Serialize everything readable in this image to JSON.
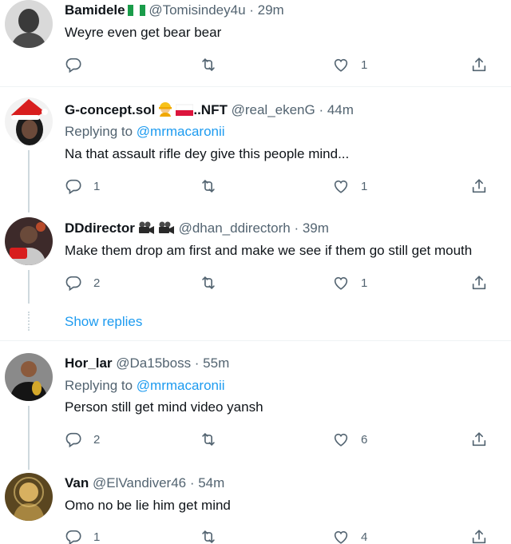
{
  "colors": {
    "link": "#1d9bf0",
    "muted": "#536471",
    "text": "#0f1419",
    "line": "#cfd9de"
  },
  "tweets": [
    {
      "name": "Bamidele",
      "flags": [
        "nigeria-flag-icon"
      ],
      "handle": "@Tomisindey4u · 29m",
      "reply_to_prefix": "",
      "reply_to_user": "",
      "text": "Weyre even get bear bear",
      "replies": "",
      "retweets": "",
      "likes": "1"
    },
    {
      "name": "G-concept.sol",
      "name_suffix": "..NFT",
      "flags": [
        "construction-worker-icon",
        "poland-flag-icon"
      ],
      "handle": "@real_ekenG · 44m",
      "reply_to_prefix": "Replying to ",
      "reply_to_user": "@mrmacaronii",
      "text": "Na that assault rifle dey give this people mind...",
      "replies": "1",
      "retweets": "",
      "likes": "1"
    },
    {
      "name": "DDdirector",
      "flags": [
        "movie-camera-icon",
        "movie-camera-icon"
      ],
      "handle": "@dhan_ddirectorh · 39m",
      "text": "Make them drop am first and make we see if them go still get mouth",
      "replies": "2",
      "retweets": "",
      "likes": "1"
    },
    {
      "name": "Hor_lar",
      "handle": "@Da15boss · 55m",
      "reply_to_prefix": "Replying to ",
      "reply_to_user": "@mrmacaronii",
      "text": "Person still get mind video yansh",
      "replies": "2",
      "retweets": "",
      "likes": "6"
    },
    {
      "name": "Van",
      "handle": "@ElVandiver46 · 54m",
      "text": "Omo no be lie him get mind",
      "replies": "1",
      "retweets": "",
      "likes": "4"
    }
  ],
  "show_replies": "Show replies"
}
